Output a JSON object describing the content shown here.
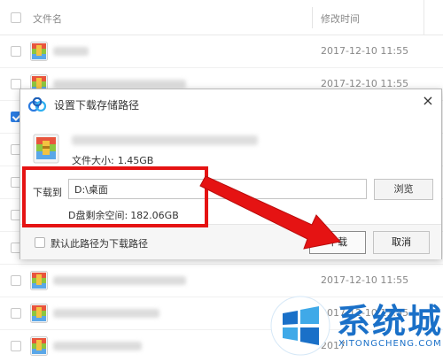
{
  "list": {
    "header": {
      "name_col": "文件名",
      "time_col": "修改时间"
    },
    "rows": [
      {
        "time": "2017-12-10 11:55",
        "checked": false
      },
      {
        "time": "2017-12-10 11:55",
        "checked": false
      },
      {
        "time": "",
        "checked": true
      },
      {
        "time": "",
        "checked": false
      },
      {
        "time": "",
        "checked": false
      },
      {
        "time": "",
        "checked": false
      },
      {
        "time": "",
        "checked": false
      },
      {
        "time": "2017-12-10 11:55",
        "checked": false
      },
      {
        "time": "2017-12-10 11:55",
        "checked": false
      },
      {
        "time": "2017",
        "checked": false
      }
    ]
  },
  "dialog": {
    "title": "设置下载存储路径",
    "close_glyph": "×",
    "file_size_label": "文件大小:",
    "file_size_value": "1.45GB",
    "path_label": "下载到",
    "path_value": "D:\\桌面",
    "browse_label": "浏览",
    "free_space_label": "D盘剩余空间:",
    "free_space_value": "182.06GB",
    "default_checkbox_label": "默认此路径为下载路径",
    "download_label": "下载",
    "cancel_label": "取消"
  },
  "annotation": {
    "color": "#e51313"
  },
  "watermark": {
    "title": "系统城",
    "subtitle": "XITONGCHENG.COM",
    "color": "#1a70c8"
  },
  "icons": {
    "file": "rar-archive-icon",
    "app": "baidu-netdisk-cloud-icon"
  }
}
